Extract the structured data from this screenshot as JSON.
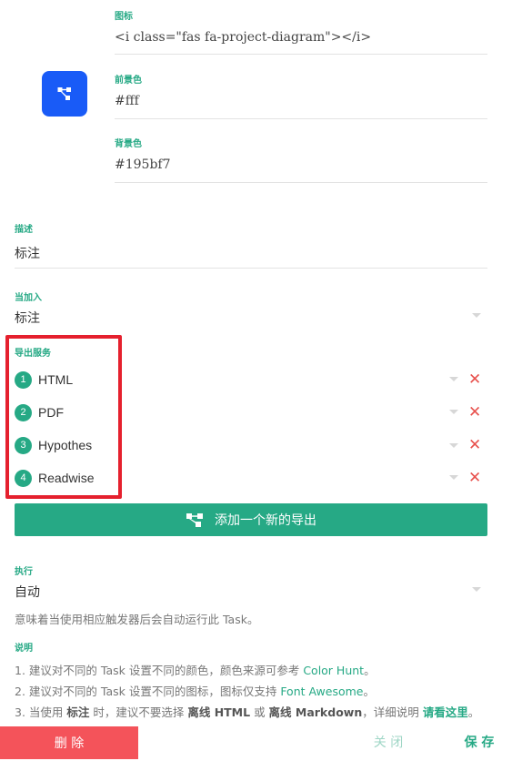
{
  "icon_field": {
    "label": "图标",
    "value": "<i class=\"fas fa-project-diagram\"></i>"
  },
  "foreground_field": {
    "label": "前景色",
    "value": "#fff"
  },
  "background_field": {
    "label": "背景色",
    "value": "#195bf7"
  },
  "description_field": {
    "label": "描述",
    "value": "标注"
  },
  "when_added_field": {
    "label": "当加入",
    "value": "标注"
  },
  "export_services": {
    "label": "导出服务",
    "items": [
      {
        "index": "1",
        "name": "HTML"
      },
      {
        "index": "2",
        "name": "PDF"
      },
      {
        "index": "3",
        "name": "Hypothes"
      },
      {
        "index": "4",
        "name": "Readwise"
      }
    ]
  },
  "add_export_button": {
    "label": "添加一个新的导出"
  },
  "execute_field": {
    "label": "执行",
    "value": "自动",
    "hint": "意味着当使用相应触发器后会自动运行此 Task。"
  },
  "notes": {
    "label": "说明",
    "line1_prefix": "1. 建议对不同的 Task 设置不同的颜色，颜色来源可参考 ",
    "line1_link": "Color Hunt",
    "line1_suffix": "。",
    "line2_prefix": "2. 建议对不同的 Task 设置不同的图标，图标仅支持 ",
    "line2_link": "Font Awesome",
    "line2_suffix": "。",
    "line3_a": "3. 当使用 ",
    "line3_b": "标注",
    "line3_c": " 时，建议不要选择 ",
    "line3_d": "离线 HTML",
    "line3_e": " 或 ",
    "line3_f": "离线 Markdown",
    "line3_g": "，详细说明 ",
    "line3_link": "请看这里",
    "line3_suffix": "。"
  },
  "footer": {
    "delete_label": "删 除",
    "close_label": "关 闭",
    "save_label": "保 存"
  },
  "colors": {
    "accent": "#26a985",
    "icon_preview_bg": "#195bf7",
    "icon_preview_fg": "#fff",
    "delete_bg": "#f4535a",
    "remove_icon": "#e8514d",
    "highlight_box": "#e5202e"
  },
  "icons": {
    "preview": "project-diagram-icon",
    "remove": "close-icon",
    "dropdown": "caret-down-icon"
  }
}
